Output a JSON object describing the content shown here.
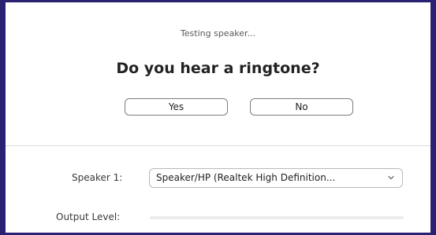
{
  "test": {
    "status": "Testing speaker...",
    "question": "Do you hear a ringtone?",
    "yes_label": "Yes",
    "no_label": "No"
  },
  "speaker": {
    "label": "Speaker 1:",
    "selected": "Speaker/HP (Realtek High Definition...",
    "dropdown_icon": "chevron-down-icon"
  },
  "output": {
    "label": "Output Level:",
    "level": 0
  },
  "colors": {
    "frame": "#2a2172",
    "level_fill": "#2d8cff",
    "level_track": "#ececec"
  }
}
